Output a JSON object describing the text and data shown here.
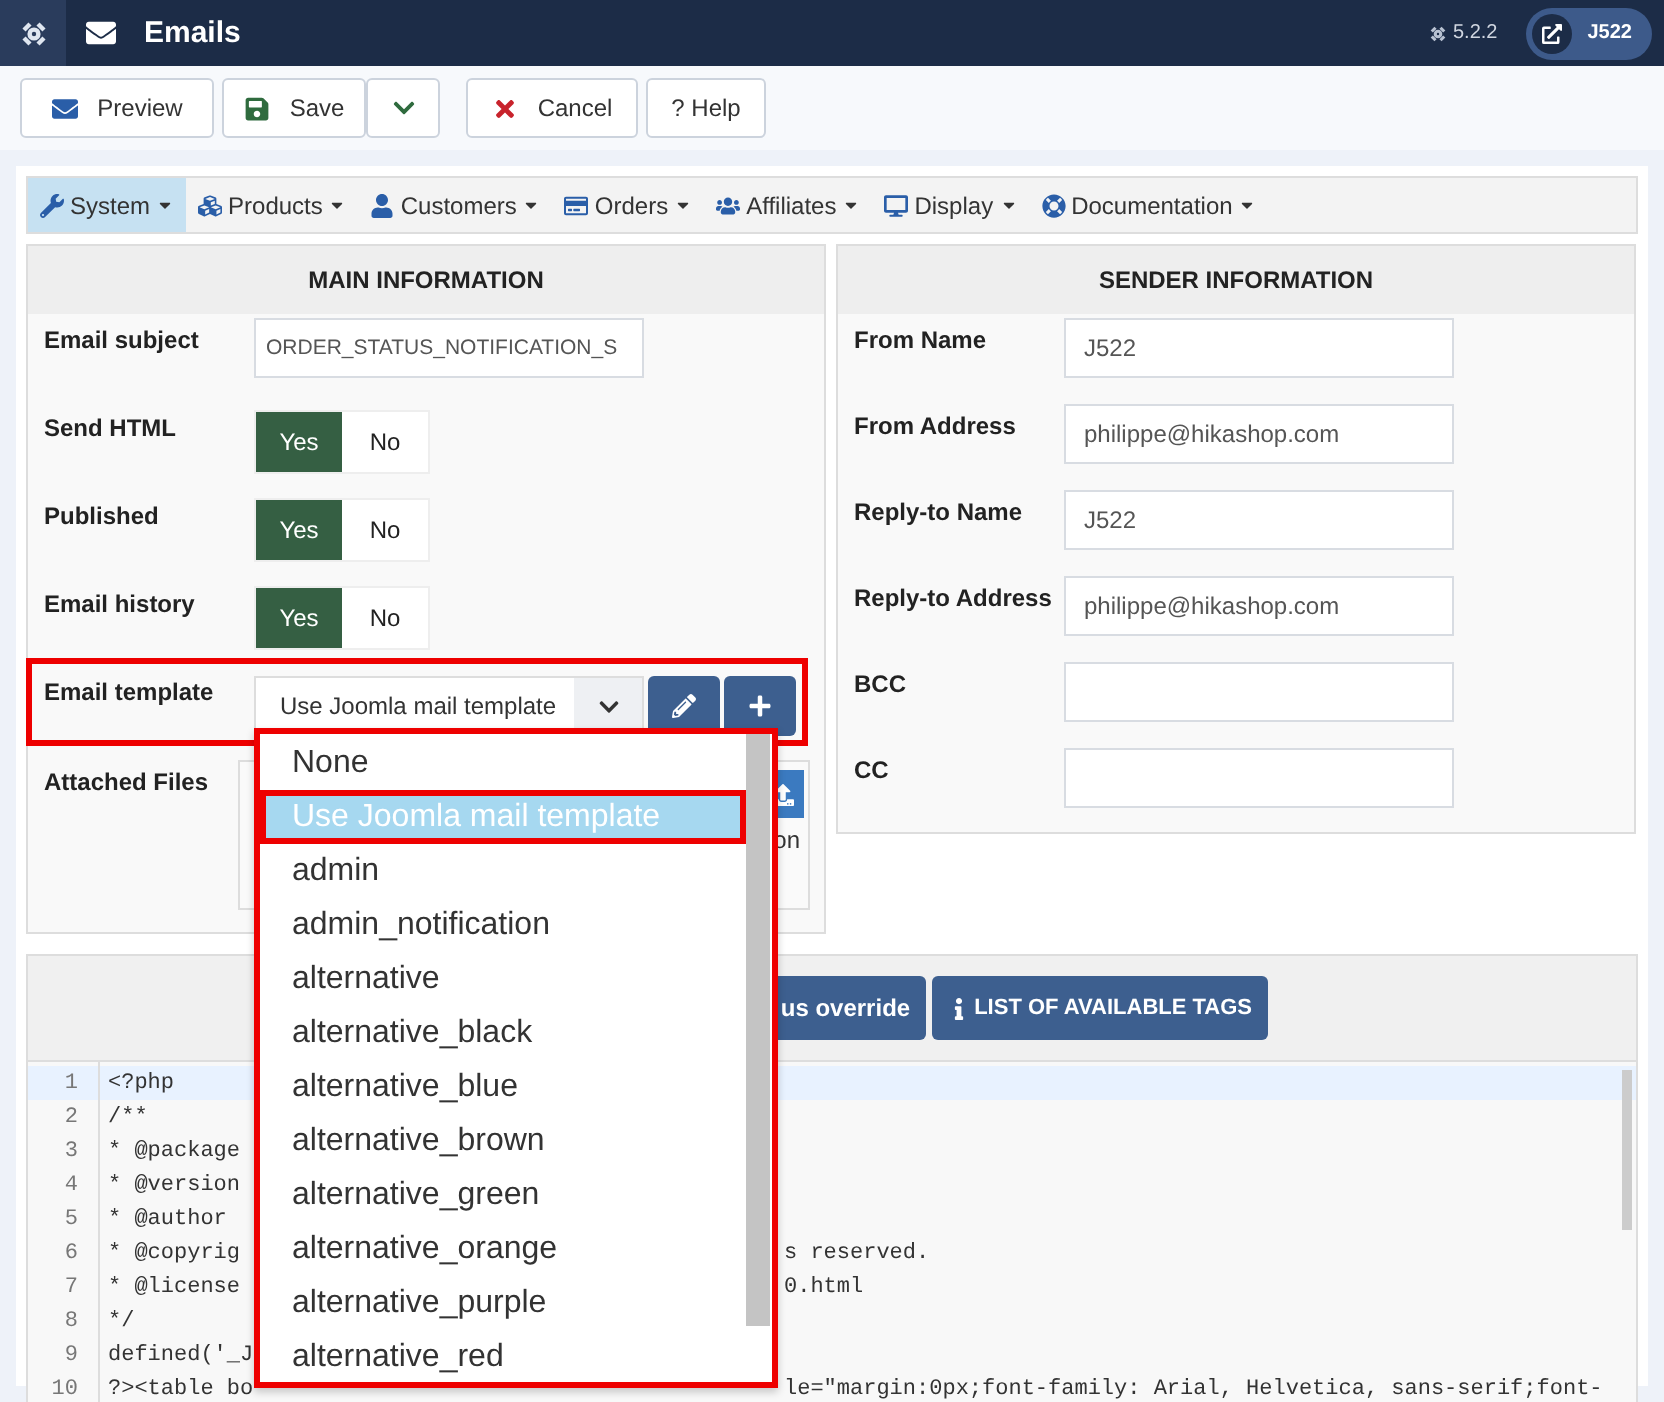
{
  "topbar": {
    "title": "Emails",
    "version": "5.2.2",
    "user": "J522"
  },
  "toolbar": [
    {
      "label": "Preview",
      "kind": "preview"
    },
    {
      "label": "Save",
      "kind": "save"
    },
    {
      "label": "Cancel",
      "kind": "cancel"
    },
    {
      "label": "? Help",
      "kind": "help"
    }
  ],
  "menu": [
    {
      "label": "System",
      "selected": true
    },
    {
      "label": "Products",
      "selected": false
    },
    {
      "label": "Customers",
      "selected": false
    },
    {
      "label": "Orders",
      "selected": false
    },
    {
      "label": "Affiliates",
      "selected": false
    },
    {
      "label": "Display",
      "selected": false
    },
    {
      "label": "Documentation",
      "selected": false
    }
  ],
  "main_information": {
    "title": "MAIN INFORMATION",
    "email_subject": {
      "label": "Email subject",
      "value": "ORDER_STATUS_NOTIFICATION_S"
    },
    "toggles": [
      {
        "label": "Send HTML",
        "yes": "Yes",
        "no": "No",
        "on": true
      },
      {
        "label": "Published",
        "yes": "Yes",
        "no": "No",
        "on": true
      },
      {
        "label": "Email history",
        "yes": "Yes",
        "no": "No",
        "on": true
      }
    ],
    "email_template": {
      "label": "Email template",
      "value": "Use Joomla mail template"
    },
    "attached_files": {
      "label": "Attached Files",
      "partial_text": "on"
    }
  },
  "sender_information": {
    "title": "SENDER INFORMATION",
    "fields": [
      {
        "label": "From Name",
        "value": "J522"
      },
      {
        "label": "From Address",
        "value": "philippe@hikashop.com"
      },
      {
        "label": "Reply-to Name",
        "value": "J522"
      },
      {
        "label": "Reply-to Address",
        "value": "philippe@hikashop.com"
      },
      {
        "label": "BCC"
      },
      {
        "label": "CC"
      }
    ]
  },
  "editor": {
    "buttons": [
      {
        "label": "us override",
        "kind": "plain"
      },
      {
        "label": "LIST OF AVAILABLE TAGS",
        "kind": "info"
      }
    ],
    "lines": [
      {
        "number": "1",
        "left": "<?php",
        "current": true
      },
      {
        "number": "2",
        "left": "/**",
        "current": false
      },
      {
        "number": "3",
        "left": " * @package",
        "current": false
      },
      {
        "number": "4",
        "left": " * @version",
        "current": false
      },
      {
        "number": "5",
        "left": " * @author",
        "current": false
      },
      {
        "number": "6",
        "left": " * @copyrig",
        "right": "s reserved.",
        "current": false
      },
      {
        "number": "7",
        "left": " * @license",
        "right": "0.html",
        "current": false
      },
      {
        "number": "8",
        "left": " */",
        "current": false
      },
      {
        "number": "9",
        "left": "defined('_J",
        "current": false
      },
      {
        "number": "10",
        "left": "?><table bo",
        "right": "le=\"margin:0px;font-family: Arial, Helvetica, sans-serif;font-",
        "current": false
      }
    ]
  },
  "dropdown": {
    "options": [
      {
        "label": "None",
        "selected": false
      },
      {
        "label": "Use Joomla mail template",
        "selected": true
      },
      {
        "label": "admin",
        "selected": false
      },
      {
        "label": "admin_notification",
        "selected": false
      },
      {
        "label": "alternative",
        "selected": false
      },
      {
        "label": "alternative_black",
        "selected": false
      },
      {
        "label": "alternative_blue",
        "selected": false
      },
      {
        "label": "alternative_brown",
        "selected": false
      },
      {
        "label": "alternative_green",
        "selected": false
      },
      {
        "label": "alternative_orange",
        "selected": false
      },
      {
        "label": "alternative_purple",
        "selected": false
      },
      {
        "label": "alternative_red",
        "selected": false
      }
    ]
  }
}
